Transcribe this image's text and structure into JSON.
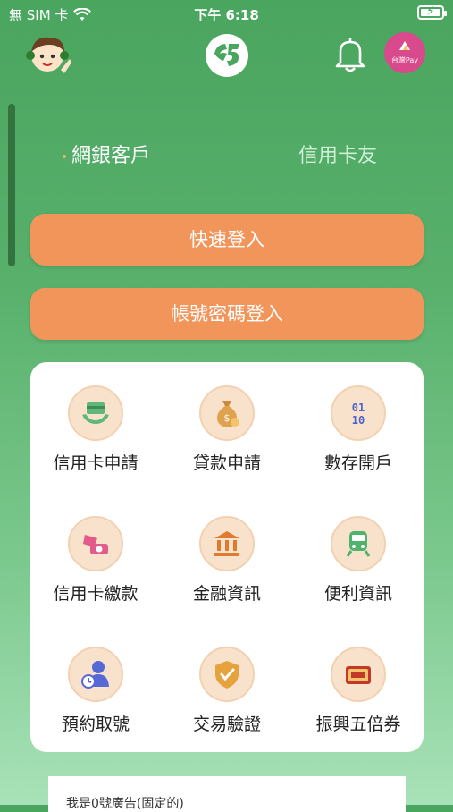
{
  "status_bar": {
    "carrier": "無 SIM 卡",
    "time": "下午 6:18"
  },
  "header": {
    "pay_badge_text": "台灣Pay"
  },
  "tabs": [
    {
      "label": "網銀客戶",
      "active": true
    },
    {
      "label": "信用卡友",
      "active": false
    }
  ],
  "buttons": {
    "quick_login": "快速登入",
    "password_login": "帳號密碼登入"
  },
  "services": [
    {
      "label": "信用卡申請",
      "icon": "card-hand-icon"
    },
    {
      "label": "貸款申請",
      "icon": "money-bag-icon"
    },
    {
      "label": "數存開戶",
      "icon": "binary-icon"
    },
    {
      "label": "信用卡繳款",
      "icon": "card-payment-icon"
    },
    {
      "label": "金融資訊",
      "icon": "bank-icon"
    },
    {
      "label": "便利資訊",
      "icon": "train-icon"
    },
    {
      "label": "預約取號",
      "icon": "person-clock-icon"
    },
    {
      "label": "交易驗證",
      "icon": "shield-check-icon"
    },
    {
      "label": "振興五倍券",
      "icon": "voucher-icon"
    }
  ],
  "ad": {
    "text": "我是0號廣告(固定的)"
  },
  "colors": {
    "accent": "#f2955a",
    "icon_bg": "#f8e2cc",
    "green": "#4aa55f"
  }
}
